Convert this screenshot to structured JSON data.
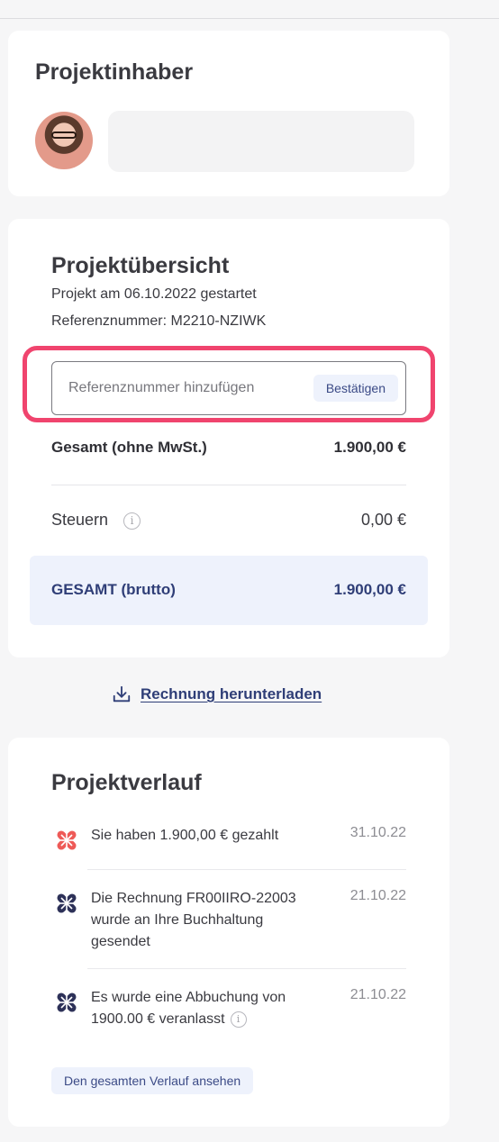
{
  "owner": {
    "title": "Projektinhaber"
  },
  "overview": {
    "title": "Projektübersicht",
    "started": "Projekt am 06.10.2022 gestartet",
    "reference": "Referenznummer: M2210-NZIWK",
    "ref_input_placeholder": "Referenznummer hinzufügen",
    "confirm_label": "Bestätigen",
    "net_label": "Gesamt (ohne MwSt.)",
    "net_value": "1.900,00 €",
    "tax_label": "Steuern",
    "tax_value": "0,00 €",
    "gross_label": "GESAMT (brutto)",
    "gross_value": "1.900,00 €"
  },
  "download": {
    "label": "Rechnung herunterladen"
  },
  "history": {
    "title": "Projektverlauf",
    "events": [
      {
        "text": "Sie haben 1.900,00 € gezahlt",
        "date": "31.10.22",
        "icon": "payment-icon"
      },
      {
        "text": "Die Rechnung FR00IIRO-22003 wurde an Ihre Buchhaltung gesendet",
        "date": "21.10.22",
        "icon": "event-icon"
      },
      {
        "text": "Es wurde eine Abbuchung von 1900.00 € veranlasst",
        "date": "21.10.22",
        "icon": "event-icon"
      }
    ],
    "view_all_label": "Den gesamten Verlauf ansehen"
  },
  "colors": {
    "accent_navy": "#2f3e77",
    "highlight_pink": "#f0446e",
    "payment_red": "#ee5a57",
    "soft_blue": "#eef2fc"
  },
  "info_glyph": "i"
}
